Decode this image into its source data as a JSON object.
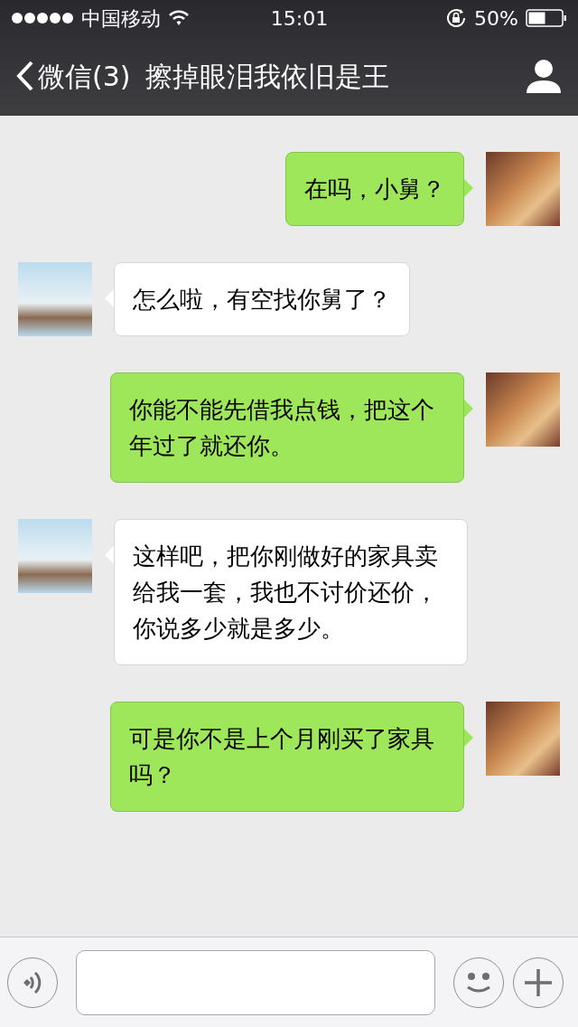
{
  "status_bar": {
    "carrier": "中国移动",
    "time": "15:01",
    "battery": "50%"
  },
  "nav_bar": {
    "back_label": "微信(3)",
    "title": "擦掉眼泪我依旧是王"
  },
  "messages": [
    {
      "kind": "sent",
      "text": "在吗，小舅？"
    },
    {
      "kind": "received",
      "text": "怎么啦，有空找你舅了？"
    },
    {
      "kind": "sent",
      "text": "你能不能先借我点钱，把这个年过了就还你。"
    },
    {
      "kind": "received",
      "text": "这样吧，把你刚做好的家具卖给我一套，我也不讨价还价，你说多少就是多少。"
    },
    {
      "kind": "sent",
      "text": "可是你不是上个月刚买了家具吗？"
    }
  ]
}
